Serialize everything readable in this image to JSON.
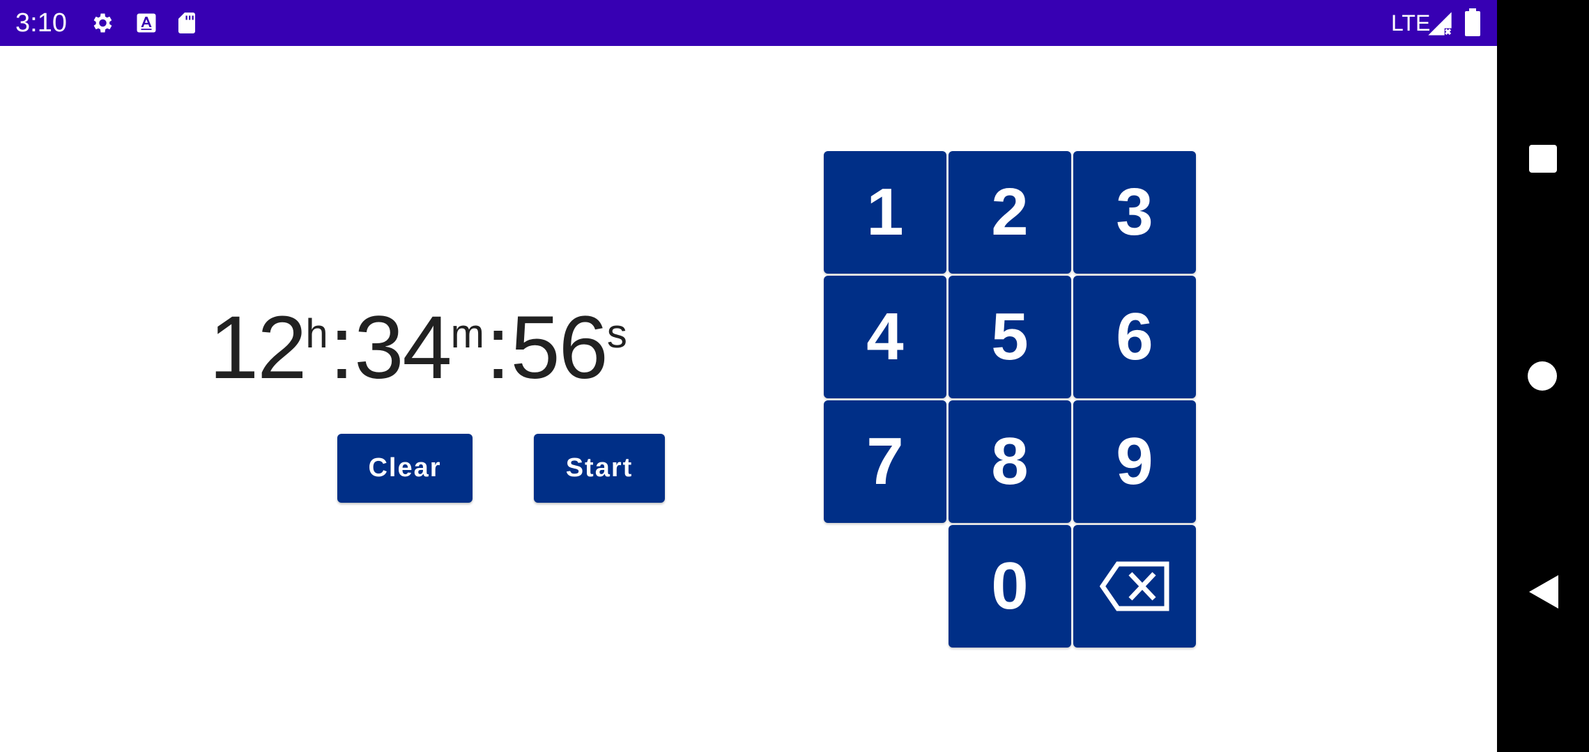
{
  "status_bar": {
    "time": "3:10",
    "network": "LTE",
    "icons": [
      "settings-icon",
      "text-a-icon",
      "sd-card-icon",
      "signal-icon",
      "battery-icon"
    ],
    "background": "#3700b3"
  },
  "timer": {
    "hours": "12",
    "hours_unit": "h",
    "minutes": "34",
    "minutes_unit": "m",
    "seconds": "56",
    "seconds_unit": "s",
    "separator": ":"
  },
  "actions": {
    "clear_label": "Clear",
    "start_label": "Start"
  },
  "keypad": {
    "keys": [
      "1",
      "2",
      "3",
      "4",
      "5",
      "6",
      "7",
      "8",
      "9",
      "0"
    ],
    "delete_icon": "backspace-icon",
    "color": "#002f87"
  },
  "nav_bar": {
    "icons": [
      "recents-icon",
      "home-icon",
      "back-icon"
    ]
  }
}
